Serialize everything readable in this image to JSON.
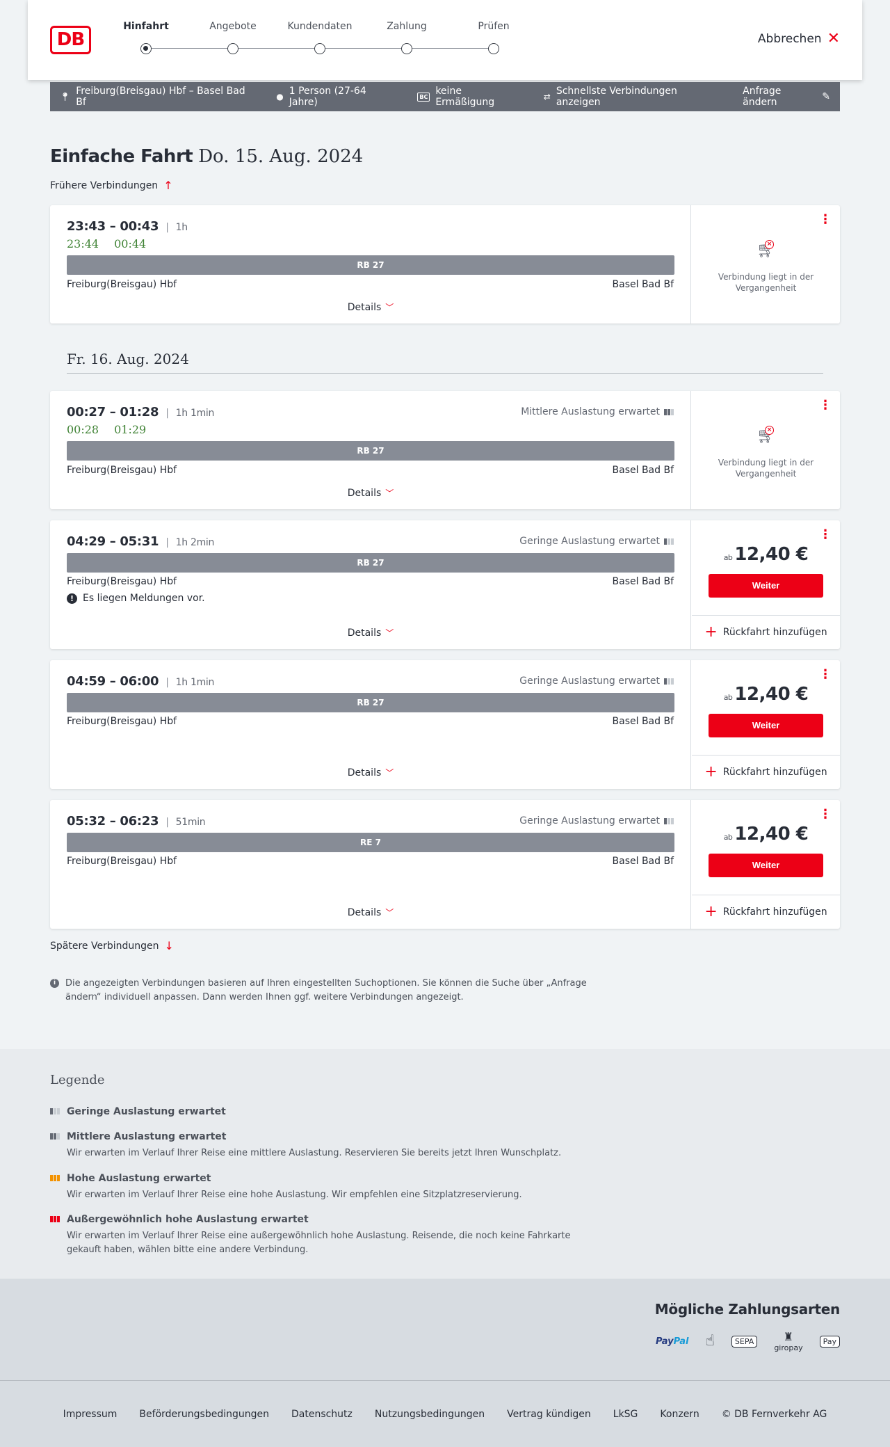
{
  "header": {
    "logo": "DB",
    "steps": [
      {
        "label": "Hinfahrt",
        "active": true
      },
      {
        "label": "Angebote",
        "active": false
      },
      {
        "label": "Kundendaten",
        "active": false
      },
      {
        "label": "Zahlung",
        "active": false
      },
      {
        "label": "Prüfen",
        "active": false
      }
    ],
    "cancel_label": "Abbrechen"
  },
  "searchbar": {
    "route": "Freiburg(Breisgau) Hbf – Basel Bad Bf",
    "travellers": "1 Person (27-64 Jahre)",
    "discount_badge": "BC",
    "discount": "keine Ermäßigung",
    "fastest": "Schnellste Verbindungen anzeigen",
    "edit": "Anfrage ändern"
  },
  "main": {
    "title_bold": "Einfache Fahrt",
    "title_date": "Do. 15. Aug. 2024",
    "earlier": "Frühere Verbindungen",
    "later": "Spätere Verbindungen",
    "date_separator": "Fr. 16. Aug. 2024",
    "details_label": "Details",
    "weiter_label": "Weiter",
    "return_label": "Rückfahrt hinzufügen",
    "past_text": "Verbindung liegt in der Vergangenheit",
    "price_prefix": "ab",
    "info": "Die angezeigten Verbindungen basieren auf Ihren eingestellten Suchoptionen. Sie können die Suche über „Anfrage ändern“ individuell anpassen. Dann werden Ihnen ggf. weitere Verbindungen angezeigt."
  },
  "connections": [
    {
      "times": "23:43 – 00:43",
      "duration": "1h",
      "rt_dep": "23:44",
      "rt_arr": "00:44",
      "train": "RB 27",
      "from": "Freiburg(Breisgau) Hbf",
      "to": "Basel Bad Bf",
      "load": "",
      "message": "",
      "price": "",
      "past": true
    },
    {
      "times": "00:27 – 01:28",
      "duration": "1h 1min",
      "rt_dep": "00:28",
      "rt_arr": "01:29",
      "train": "RB 27",
      "from": "Freiburg(Breisgau) Hbf",
      "to": "Basel Bad Bf",
      "load": "Mittlere Auslastung erwartet",
      "message": "",
      "price": "",
      "past": true
    },
    {
      "times": "04:29 – 05:31",
      "duration": "1h 2min",
      "rt_dep": "",
      "rt_arr": "",
      "train": "RB 27",
      "from": "Freiburg(Breisgau) Hbf",
      "to": "Basel Bad Bf",
      "load": "Geringe Auslastung erwartet",
      "message": "Es liegen Meldungen vor.",
      "price": "12,40 €",
      "past": false
    },
    {
      "times": "04:59 – 06:00",
      "duration": "1h 1min",
      "rt_dep": "",
      "rt_arr": "",
      "train": "RB 27",
      "from": "Freiburg(Breisgau) Hbf",
      "to": "Basel Bad Bf",
      "load": "Geringe Auslastung erwartet",
      "message": "",
      "price": "12,40 €",
      "past": false
    },
    {
      "times": "05:32 – 06:23",
      "duration": "51min",
      "rt_dep": "",
      "rt_arr": "",
      "train": "RE 7",
      "from": "Freiburg(Breisgau) Hbf",
      "to": "Basel Bad Bf",
      "load": "Geringe Auslastung erwartet",
      "message": "",
      "price": "12,40 €",
      "past": false
    }
  ],
  "legend": {
    "title": "Legende",
    "items": [
      {
        "title": "Geringe Auslastung erwartet",
        "desc": ""
      },
      {
        "title": "Mittlere Auslastung erwartet",
        "desc": "Wir erwarten im Verlauf Ihrer Reise eine mittlere Auslastung. Reservieren Sie bereits jetzt Ihren Wunschplatz."
      },
      {
        "title": "Hohe Auslastung erwartet",
        "desc": "Wir erwarten im Verlauf Ihrer Reise eine hohe Auslastung. Wir empfehlen eine Sitzplatzreservierung."
      },
      {
        "title": "Außergewöhnlich hohe Auslastung erwartet",
        "desc": "Wir erwarten im Verlauf Ihrer Reise eine außergewöhnlich hohe Auslastung. Reisende, die noch keine Fahrkarte gekauft haben, wählen bitte eine andere Verbindung."
      }
    ]
  },
  "payment": {
    "title": "Mögliche Zahlungsarten",
    "paypal_a": "Pay",
    "paypal_b": "Pal",
    "sepa": "SEPA",
    "giropay": "giropay",
    "applepay": "Pay"
  },
  "footer": {
    "links": [
      "Impressum",
      "Beförderungsbedingungen",
      "Datenschutz",
      "Nutzungsbedingungen",
      "Vertrag kündigen",
      "LkSG",
      "Konzern",
      "© DB Fernverkehr AG"
    ]
  },
  "colors": {
    "brand_red": "#ec0016",
    "realtime_green": "#408335",
    "train_bar": "#878c96",
    "searchbar": "#646973"
  }
}
